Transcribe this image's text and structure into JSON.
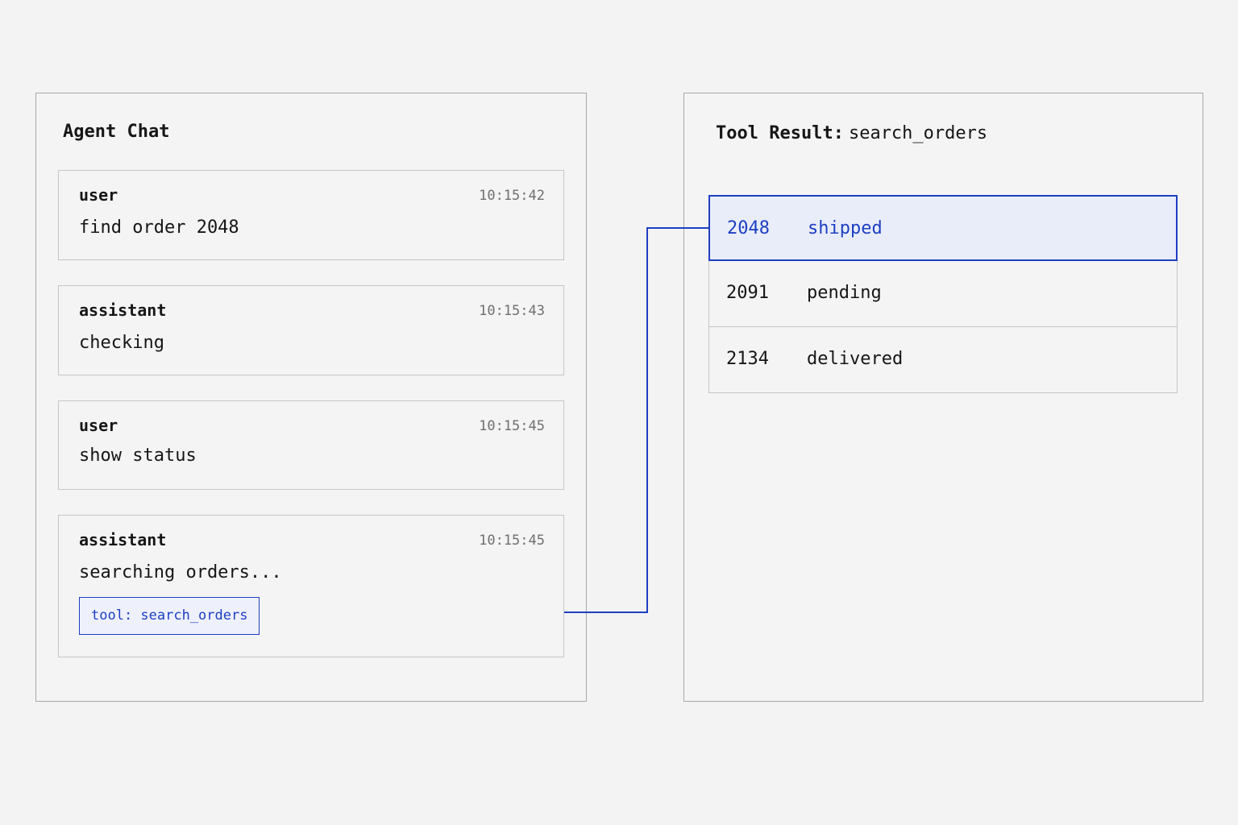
{
  "chat": {
    "title": "Agent Chat",
    "messages": [
      {
        "role": "user",
        "time": "10:15:42",
        "text": "find order 2048"
      },
      {
        "role": "assistant",
        "time": "10:15:43",
        "text": "checking"
      },
      {
        "role": "user",
        "time": "10:15:45",
        "text": "show status"
      },
      {
        "role": "assistant",
        "time": "10:15:45",
        "text": "searching orders...",
        "tool_label": "tool: search_orders"
      }
    ]
  },
  "result": {
    "title": "Tool Result:",
    "tool_name": "search_orders",
    "rows": [
      {
        "id": "2048",
        "status": "shipped",
        "highlighted": true
      },
      {
        "id": "2091",
        "status": "pending",
        "highlighted": false
      },
      {
        "id": "2134",
        "status": "delivered",
        "highlighted": false
      }
    ]
  },
  "colors": {
    "accent": "#1d3fc2",
    "highlight_bg": "#e9edfa",
    "background": "#f3f3f3"
  }
}
